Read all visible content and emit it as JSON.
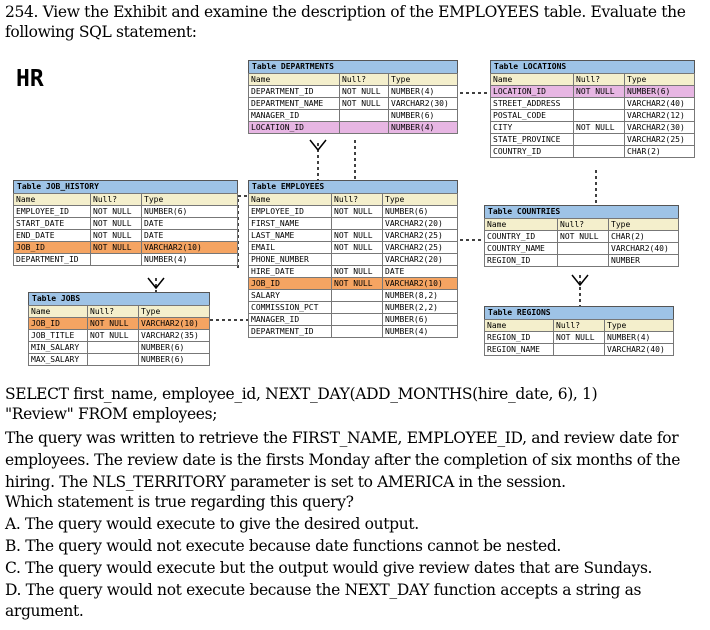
{
  "question": {
    "line1": "254. View the Exhibit and examine the description of the EMPLOYEES table. Evaluate the",
    "line2": "following SQL statement:"
  },
  "schema_label": "HR",
  "tables": {
    "departments": {
      "title": "Table DEPARTMENTS",
      "headers": [
        "Name",
        "Null?",
        "Type"
      ],
      "rows": [
        [
          "DEPARTMENT_ID",
          "NOT NULL",
          "NUMBER(4)"
        ],
        [
          "DEPARTMENT_NAME",
          "NOT NULL",
          "VARCHAR2(30)"
        ],
        [
          "MANAGER_ID",
          "",
          "NUMBER(6)"
        ],
        [
          "LOCATION_ID",
          "",
          "NUMBER(4)"
        ]
      ]
    },
    "locations": {
      "title": "Table LOCATIONS",
      "headers": [
        "Name",
        "Null?",
        "Type"
      ],
      "rows": [
        [
          "LOCATION_ID",
          "NOT NULL",
          "NUMBER(6)"
        ],
        [
          "STREET_ADDRESS",
          "",
          "VARCHAR2(40)"
        ],
        [
          "POSTAL_CODE",
          "",
          "VARCHAR2(12)"
        ],
        [
          "CITY",
          "NOT NULL",
          "VARCHAR2(30)"
        ],
        [
          "STATE_PROVINCE",
          "",
          "VARCHAR2(25)"
        ],
        [
          "COUNTRY_ID",
          "",
          "CHAR(2)"
        ]
      ]
    },
    "job_history": {
      "title": "Table JOB_HISTORY",
      "headers": [
        "Name",
        "Null?",
        "Type"
      ],
      "rows": [
        [
          "EMPLOYEE_ID",
          "NOT NULL",
          "NUMBER(6)"
        ],
        [
          "START_DATE",
          "NOT NULL",
          "DATE"
        ],
        [
          "END_DATE",
          "NOT NULL",
          "DATE"
        ],
        [
          "JOB_ID",
          "NOT NULL",
          "VARCHAR2(10)"
        ],
        [
          "DEPARTMENT_ID",
          "",
          "NUMBER(4)"
        ]
      ]
    },
    "employees": {
      "title": "Table EMPLOYEES",
      "headers": [
        "Name",
        "Null?",
        "Type"
      ],
      "rows": [
        [
          "EMPLOYEE_ID",
          "NOT NULL",
          "NUMBER(6)"
        ],
        [
          "FIRST_NAME",
          "",
          "VARCHAR2(20)"
        ],
        [
          "LAST_NAME",
          "NOT NULL",
          "VARCHAR2(25)"
        ],
        [
          "EMAIL",
          "NOT NULL",
          "VARCHAR2(25)"
        ],
        [
          "PHONE_NUMBER",
          "",
          "VARCHAR2(20)"
        ],
        [
          "HIRE_DATE",
          "NOT NULL",
          "DATE"
        ],
        [
          "JOB_ID",
          "NOT NULL",
          "VARCHAR2(10)"
        ],
        [
          "SALARY",
          "",
          "NUMBER(8,2)"
        ],
        [
          "COMMISSION_PCT",
          "",
          "NUMBER(2,2)"
        ],
        [
          "MANAGER_ID",
          "",
          "NUMBER(6)"
        ],
        [
          "DEPARTMENT_ID",
          "",
          "NUMBER(4)"
        ]
      ]
    },
    "countries": {
      "title": "Table COUNTRIES",
      "headers": [
        "Name",
        "Null?",
        "Type"
      ],
      "rows": [
        [
          "COUNTRY_ID",
          "NOT NULL",
          "CHAR(2)"
        ],
        [
          "COUNTRY_NAME",
          "",
          "VARCHAR2(40)"
        ],
        [
          "REGION_ID",
          "",
          "NUMBER"
        ]
      ]
    },
    "jobs": {
      "title": "Table JOBS",
      "headers": [
        "Name",
        "Null?",
        "Type"
      ],
      "rows": [
        [
          "JOB_ID",
          "NOT NULL",
          "VARCHAR2(10)"
        ],
        [
          "JOB_TITLE",
          "NOT NULL",
          "VARCHAR2(35)"
        ],
        [
          "MIN_SALARY",
          "",
          "NUMBER(6)"
        ],
        [
          "MAX_SALARY",
          "",
          "NUMBER(6)"
        ]
      ]
    },
    "regions": {
      "title": "Table REGIONS",
      "headers": [
        "Name",
        "Null?",
        "Type"
      ],
      "rows": [
        [
          "REGION_ID",
          "NOT NULL",
          "NUMBER(4)"
        ],
        [
          "REGION_NAME",
          "",
          "VARCHAR2(40)"
        ]
      ]
    }
  },
  "body": {
    "sql1": "SELECT first_name, employee_id, NEXT_DAY(ADD_MONTHS(hire_date, 6), 1)",
    "sql2": "\"Review\" FROM employees;",
    "desc1": "The query was written to retrieve the FIRST_NAME, EMPLOYEE_ID, and review date for",
    "desc2": "employees. The review date is the firsts Monday after the completion of six months of the",
    "desc3": "hiring. The NLS_TERRITORY parameter is set to AMERICA in the session.",
    "ask": "Which statement is true regarding this query?",
    "optA": "A. The query would execute to give the desired output.",
    "optB": "B. The query would not execute because date functions cannot be nested.",
    "optC": "C. The query would execute but the output would give review dates that are Sundays.",
    "optD1": "D. The query would not execute because the NEXT_DAY function accepts a string as",
    "optD2": "argument."
  }
}
